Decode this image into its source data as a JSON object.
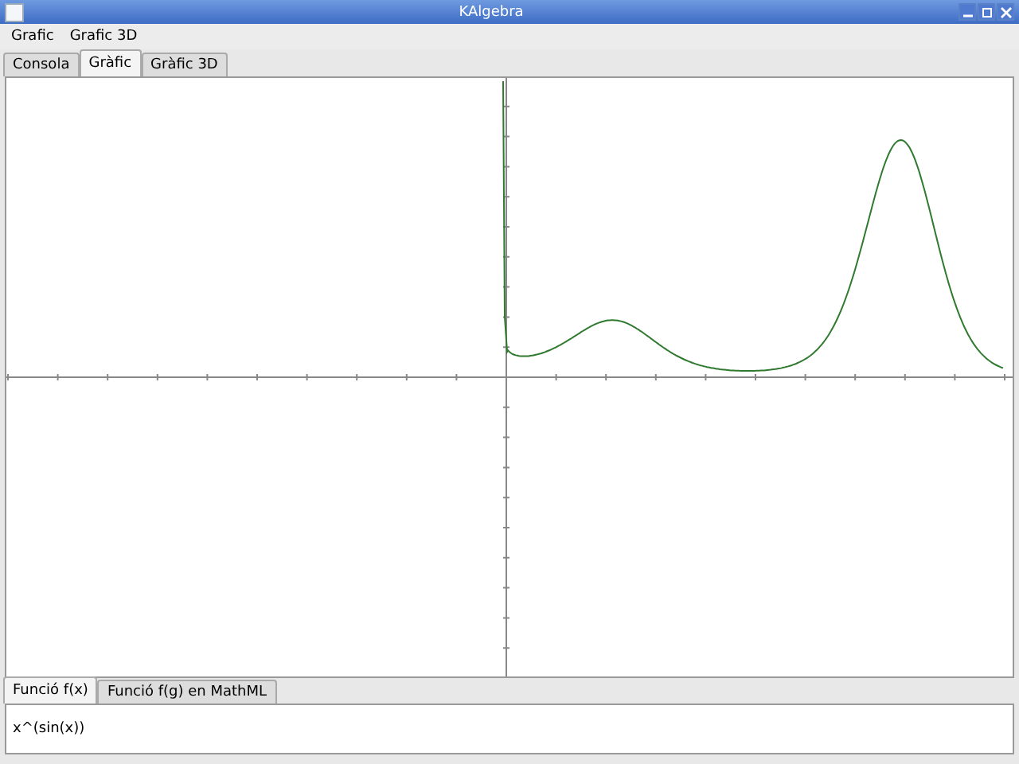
{
  "window": {
    "title": "KAlgebra"
  },
  "menu": [
    {
      "label": "Grafic"
    },
    {
      "label": "Grafic 3D"
    }
  ],
  "tabs": [
    {
      "label": "Consola",
      "selected": false
    },
    {
      "label": "Gràfic",
      "selected": true
    },
    {
      "label": "Gràfic 3D",
      "selected": false
    }
  ],
  "function_tabs": [
    {
      "label": "Funció f(x)",
      "selected": true
    },
    {
      "label": "Funció f(g) en MathML",
      "selected": false
    }
  ],
  "function_input": {
    "value": "x^(sin(x))"
  }
}
